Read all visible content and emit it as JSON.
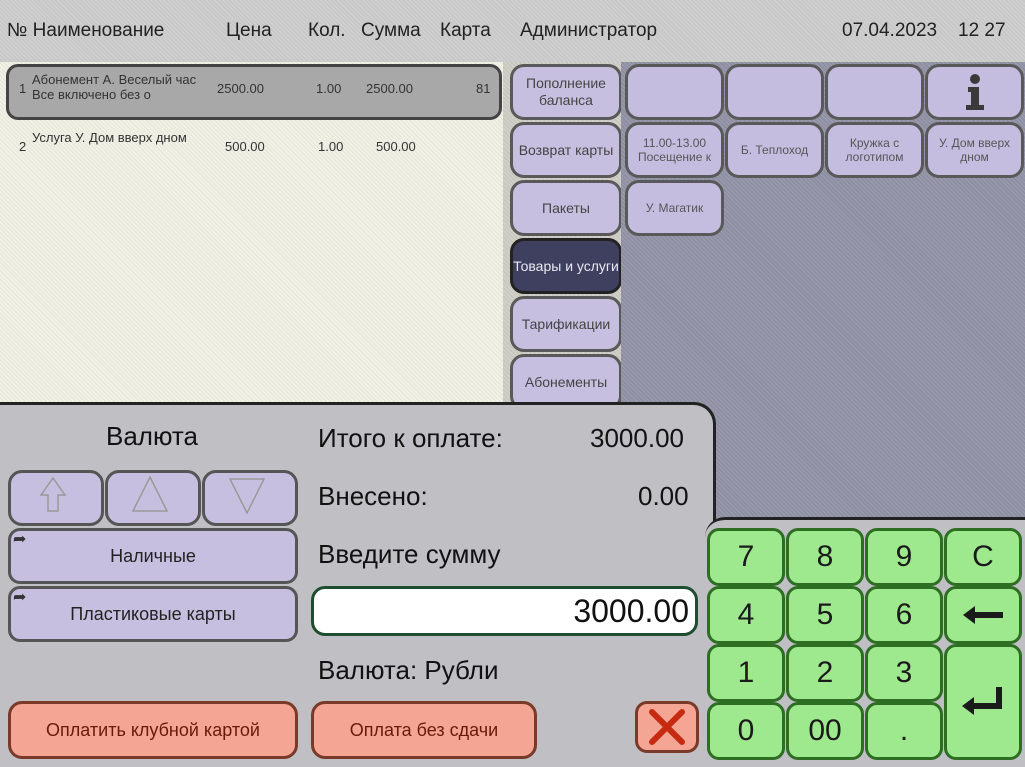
{
  "header": {
    "col_num_name": "№ Наименование",
    "col_price": "Цена",
    "col_qty": "Кол.",
    "col_sum": "Сумма",
    "col_card": "Карта",
    "user": "Администратор",
    "date": "07.04.2023",
    "time": "12 27"
  },
  "order": {
    "items": [
      {
        "num": "1",
        "name": "Абонемент А. Веселый час Все включено без о",
        "price": "2500.00",
        "qty": "1.00",
        "sum": "2500.00",
        "card": "81"
      },
      {
        "num": "2",
        "name": "Услуга У. Дом вверх дном",
        "price": "500.00",
        "qty": "1.00",
        "sum": "500.00",
        "card": ""
      }
    ]
  },
  "categories": [
    {
      "label": "Пополнение баланса"
    },
    {
      "label": "Возврат карты"
    },
    {
      "label": "Пакеты"
    },
    {
      "label": "Товары и услуги"
    },
    {
      "label": "Тарификации"
    },
    {
      "label": "Абонементы"
    }
  ],
  "items": [
    {
      "label": "11.00-13.00 Посещение к"
    },
    {
      "label": "Б. Теплоход"
    },
    {
      "label": "Кружка с логотипом"
    },
    {
      "label": "У. Дом вверх дном"
    },
    {
      "label": "У. Магатик"
    }
  ],
  "payment": {
    "currency_title": "Валюта",
    "total_label": "Итого к оплате:",
    "total_value": "3000.00",
    "paid_label": "Внесено:",
    "paid_value": "0.00",
    "enter_label": "Введите сумму",
    "amount": "3000.00",
    "currency_label": "Валюта: Рубли",
    "methods": [
      {
        "label": "Наличные"
      },
      {
        "label": "Пластиковые карты"
      }
    ],
    "club_card_label": "Оплатить клубной картой",
    "no_change_label": "Оплата без сдачи"
  },
  "keypad": [
    "7",
    "8",
    "9",
    "C",
    "4",
    "5",
    "6",
    "1",
    "2",
    "3",
    "0",
    "00",
    "."
  ],
  "colors": {
    "keypad": "#9ee88d",
    "button_lavender": "#c7bfe0",
    "button_salmon": "#f4a593",
    "active_category": "#3f4060"
  }
}
